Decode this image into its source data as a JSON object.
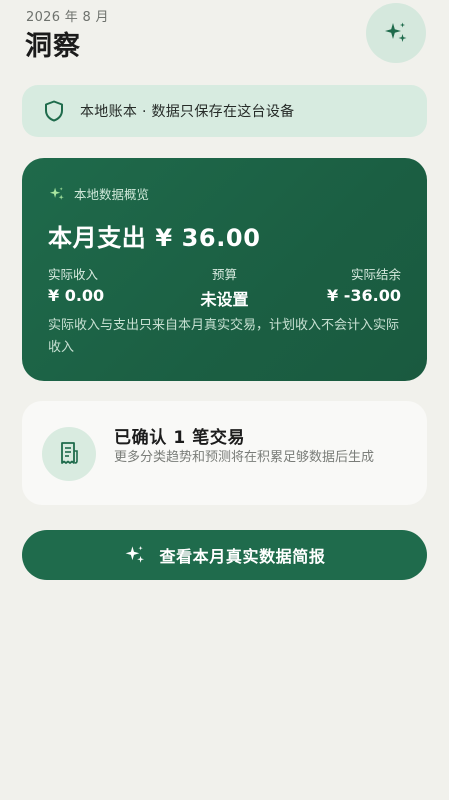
{
  "header": {
    "date": "2026 年 8 月",
    "title": "洞察",
    "sparkle_icon": "sparkle-icon"
  },
  "privacy": {
    "icon": "shield-icon",
    "text": "本地账本 · 数据只保存在这台设备"
  },
  "overview": {
    "chip_icon": "sparkle-icon",
    "chip_label": "本地数据概览",
    "headline": "本月支出 ¥ 36.00",
    "stats": [
      {
        "label": "实际收入",
        "value": "¥ 0.00"
      },
      {
        "label": "预算",
        "value": "未设置"
      },
      {
        "label": "实际结余",
        "value": "¥ -36.00"
      }
    ],
    "note": "实际收入与支出只来自本月真实交易，计划收入不会计入实际收入"
  },
  "confirm": {
    "icon": "receipt-icon",
    "title": "已确认 1 笔交易",
    "subtitle": "更多分类趋势和预测将在积累足够数据后生成"
  },
  "report_button": {
    "icon": "sparkle-icon",
    "label": "查看本月真实数据简报"
  },
  "colors": {
    "background": "#f1f1ec",
    "accent": "#1f6b4c",
    "accent_light": "#d7ebe0"
  }
}
